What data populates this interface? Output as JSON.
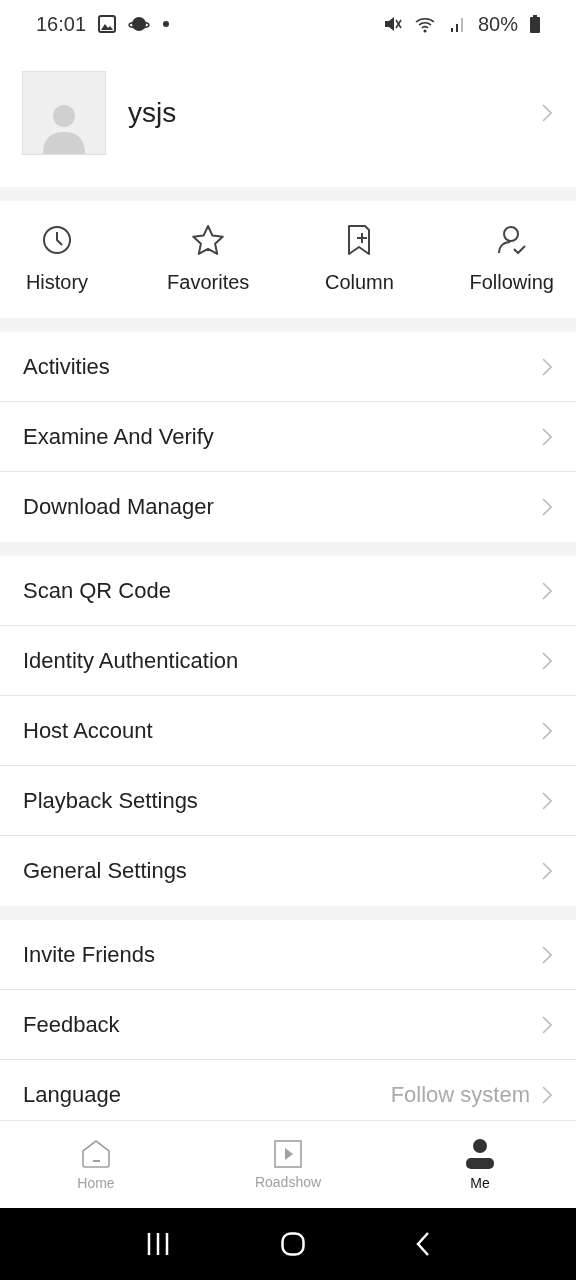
{
  "status_bar": {
    "time": "16:01",
    "battery": "80%"
  },
  "profile": {
    "username": "ysjs"
  },
  "shortcuts": [
    {
      "kind": "history",
      "label": "History"
    },
    {
      "kind": "favorites",
      "label": "Favorites"
    },
    {
      "kind": "column",
      "label": "Column"
    },
    {
      "kind": "following",
      "label": "Following"
    }
  ],
  "menu_sections": [
    {
      "rows": [
        {
          "label": "Activities"
        },
        {
          "label": "Examine And Verify"
        },
        {
          "label": "Download Manager"
        }
      ]
    },
    {
      "rows": [
        {
          "label": "Scan QR Code"
        },
        {
          "label": "Identity Authentication"
        },
        {
          "label": "Host Account"
        },
        {
          "label": "Playback Settings"
        },
        {
          "label": "General Settings"
        }
      ]
    },
    {
      "rows": [
        {
          "label": "Invite Friends"
        },
        {
          "label": "Feedback"
        },
        {
          "label": "Language",
          "value": "Follow system"
        }
      ]
    }
  ],
  "tab_bar": [
    {
      "kind": "home",
      "label": "Home",
      "selected": false
    },
    {
      "kind": "roadshow",
      "label": "Roadshow",
      "selected": false
    },
    {
      "kind": "me",
      "label": "Me",
      "selected": true
    }
  ]
}
